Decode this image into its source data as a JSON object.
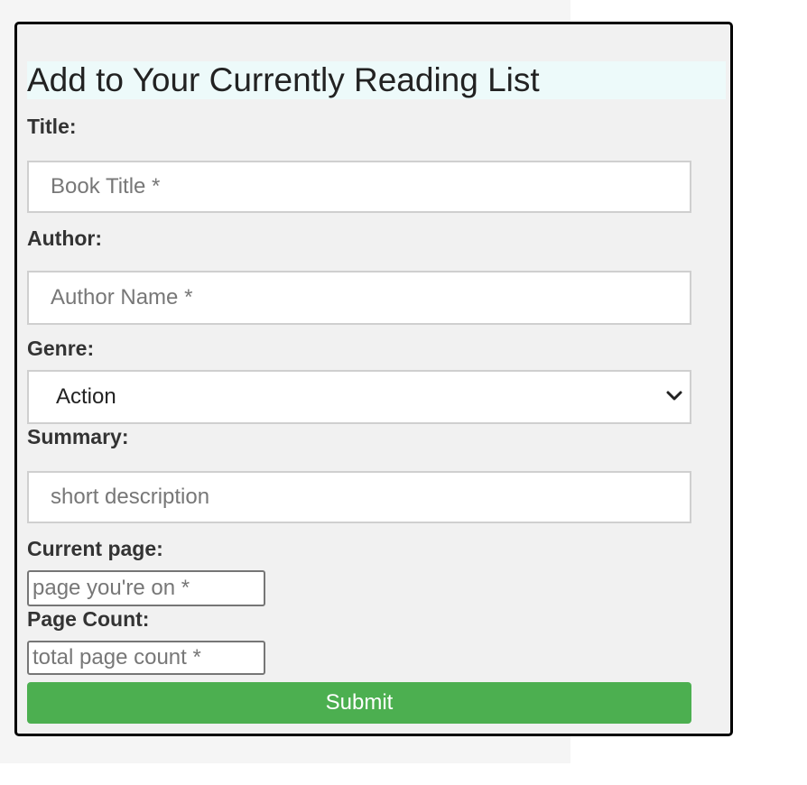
{
  "form": {
    "title": "Add to Your Currently Reading List",
    "fields": {
      "title": {
        "label": "Title:",
        "placeholder": "Book Title *"
      },
      "author": {
        "label": "Author:",
        "placeholder": "Author Name *"
      },
      "genre": {
        "label": "Genre:",
        "selected": "Action"
      },
      "summary": {
        "label": "Summary:",
        "placeholder": "short description"
      },
      "current_page": {
        "label": "Current page:",
        "placeholder": "page you're on *"
      },
      "page_count": {
        "label": "Page Count:",
        "placeholder": "total page count *"
      }
    },
    "submit_label": "Submit"
  },
  "colors": {
    "title_highlight": "#edfafa",
    "submit_button": "#4caf50",
    "card_background": "#f1f1f1",
    "card_border": "#000000"
  },
  "icons": {
    "genre_dropdown": "chevron-down-icon"
  }
}
